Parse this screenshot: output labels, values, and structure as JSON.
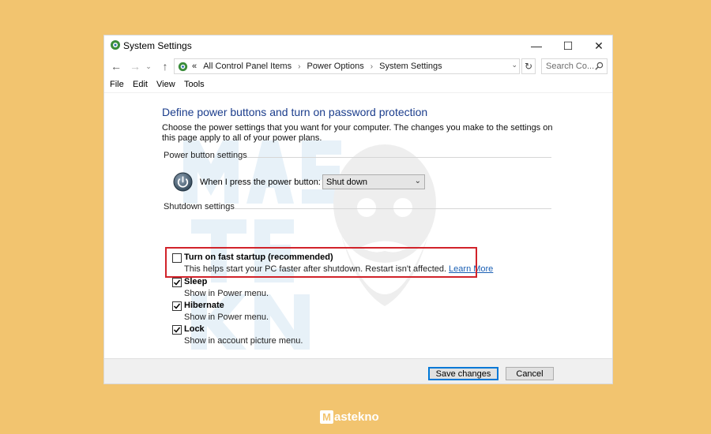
{
  "window": {
    "title": "System Settings",
    "min_glyph": "—",
    "max_glyph": "☐",
    "close_glyph": "✕"
  },
  "nav": {
    "back_glyph": "←",
    "forward_glyph": "→",
    "recent_glyph": "⌄",
    "up_glyph": "↑",
    "crumb_overflow": "«",
    "breadcrumbs": [
      "All Control Panel Items",
      "Power Options",
      "System Settings"
    ],
    "crumb_sep": "›",
    "dropdown_glyph": "⌄",
    "refresh_glyph": "↻",
    "search_placeholder": "Search Co..."
  },
  "menu": {
    "file": "File",
    "edit": "Edit",
    "view": "View",
    "tools": "Tools"
  },
  "content": {
    "heading": "Define power buttons and turn on password protection",
    "description": "Choose the power settings that you want for your computer. The changes you make to the settings on this page apply to all of your power plans.",
    "power_group": "Power button settings",
    "power_label": "When I press the power button:",
    "power_value": "Shut down",
    "power_arrow": "⌄",
    "shutdown_group": "Shutdown settings",
    "options": [
      {
        "title": "Turn on fast startup (recommended)",
        "desc": "This helps start your PC faster after shutdown. Restart isn't affected.",
        "link": "Learn More",
        "checked": false
      },
      {
        "title": "Sleep",
        "desc": "Show in Power menu.",
        "checked": true
      },
      {
        "title": "Hibernate",
        "desc": "Show in Power menu.",
        "checked": true
      },
      {
        "title": "Lock",
        "desc": "Show in account picture menu.",
        "checked": true
      }
    ]
  },
  "footer": {
    "save": "Save changes",
    "cancel": "Cancel"
  },
  "brand": {
    "letter": "M",
    "rest": "astekno"
  },
  "colors": {
    "background": "#f2c46f",
    "heading": "#1b3d8c",
    "highlight": "#d1232a",
    "link": "#1a5fb4"
  }
}
